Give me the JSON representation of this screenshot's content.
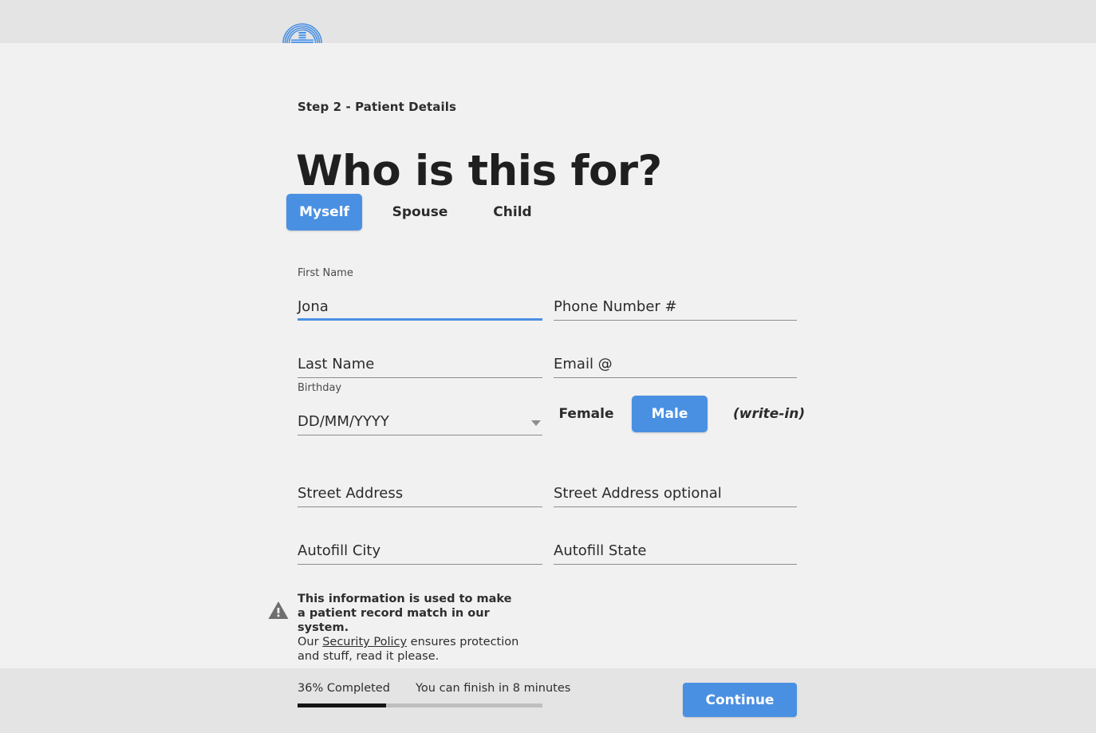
{
  "brand": {
    "logo_icon": "medical-cross-circle-logo",
    "logo_color": "#4a90e2"
  },
  "header": {
    "step_label": "Step 2 - Patient Details",
    "title": "Who is this for?"
  },
  "tabs": [
    {
      "label": "Myself",
      "active": true
    },
    {
      "label": "Spouse",
      "active": false
    },
    {
      "label": "Child",
      "active": false
    }
  ],
  "form": {
    "first_name": {
      "label": "First Name",
      "value": "Jona",
      "placeholder": "First Name",
      "focused": true
    },
    "phone": {
      "label": "",
      "value": "",
      "placeholder": "Phone Number #",
      "focused": false
    },
    "last_name": {
      "label": "",
      "value": "",
      "placeholder": "Last Name",
      "focused": false
    },
    "email": {
      "label": "",
      "value": "",
      "placeholder": "Email @",
      "focused": false
    },
    "birthday": {
      "label": "Birthday",
      "value": "",
      "placeholder": "DD/MM/YYYY",
      "focused": false,
      "caret_icon": "chevron-down-icon"
    },
    "street1": {
      "label": "",
      "value": "",
      "placeholder": "Street Address",
      "focused": false
    },
    "street2": {
      "label": "",
      "value": "",
      "placeholder": "Street Address optional",
      "focused": false
    },
    "city": {
      "label": "",
      "value": "",
      "placeholder": "Autofill City",
      "focused": false
    },
    "state": {
      "label": "",
      "value": "",
      "placeholder": "Autofill State",
      "focused": false
    }
  },
  "gender": [
    {
      "label": "Female",
      "active": false
    },
    {
      "label": "Male",
      "active": true
    },
    {
      "label": "(write-in)",
      "active": false
    }
  ],
  "notice": {
    "icon": "warning-triangle-icon",
    "line1": "This information is used to make",
    "line2": "a patient record match in our system.",
    "line3_before": "Our ",
    "link": "Security Policy",
    "line3_after": " ensures protection",
    "line4": "and stuff, read it please."
  },
  "footer": {
    "percent_label": "36% Completed",
    "eta_label": "You can finish in 8 minutes",
    "progress_percent": 36,
    "continue_label": "Continue"
  },
  "colors": {
    "accent": "#4a90e2",
    "band": "#e4e4e4",
    "page": "#f1f1f1",
    "progress_fill": "#151515",
    "progress_track": "#bfbfbf",
    "field_line": "#8d8d8d"
  }
}
